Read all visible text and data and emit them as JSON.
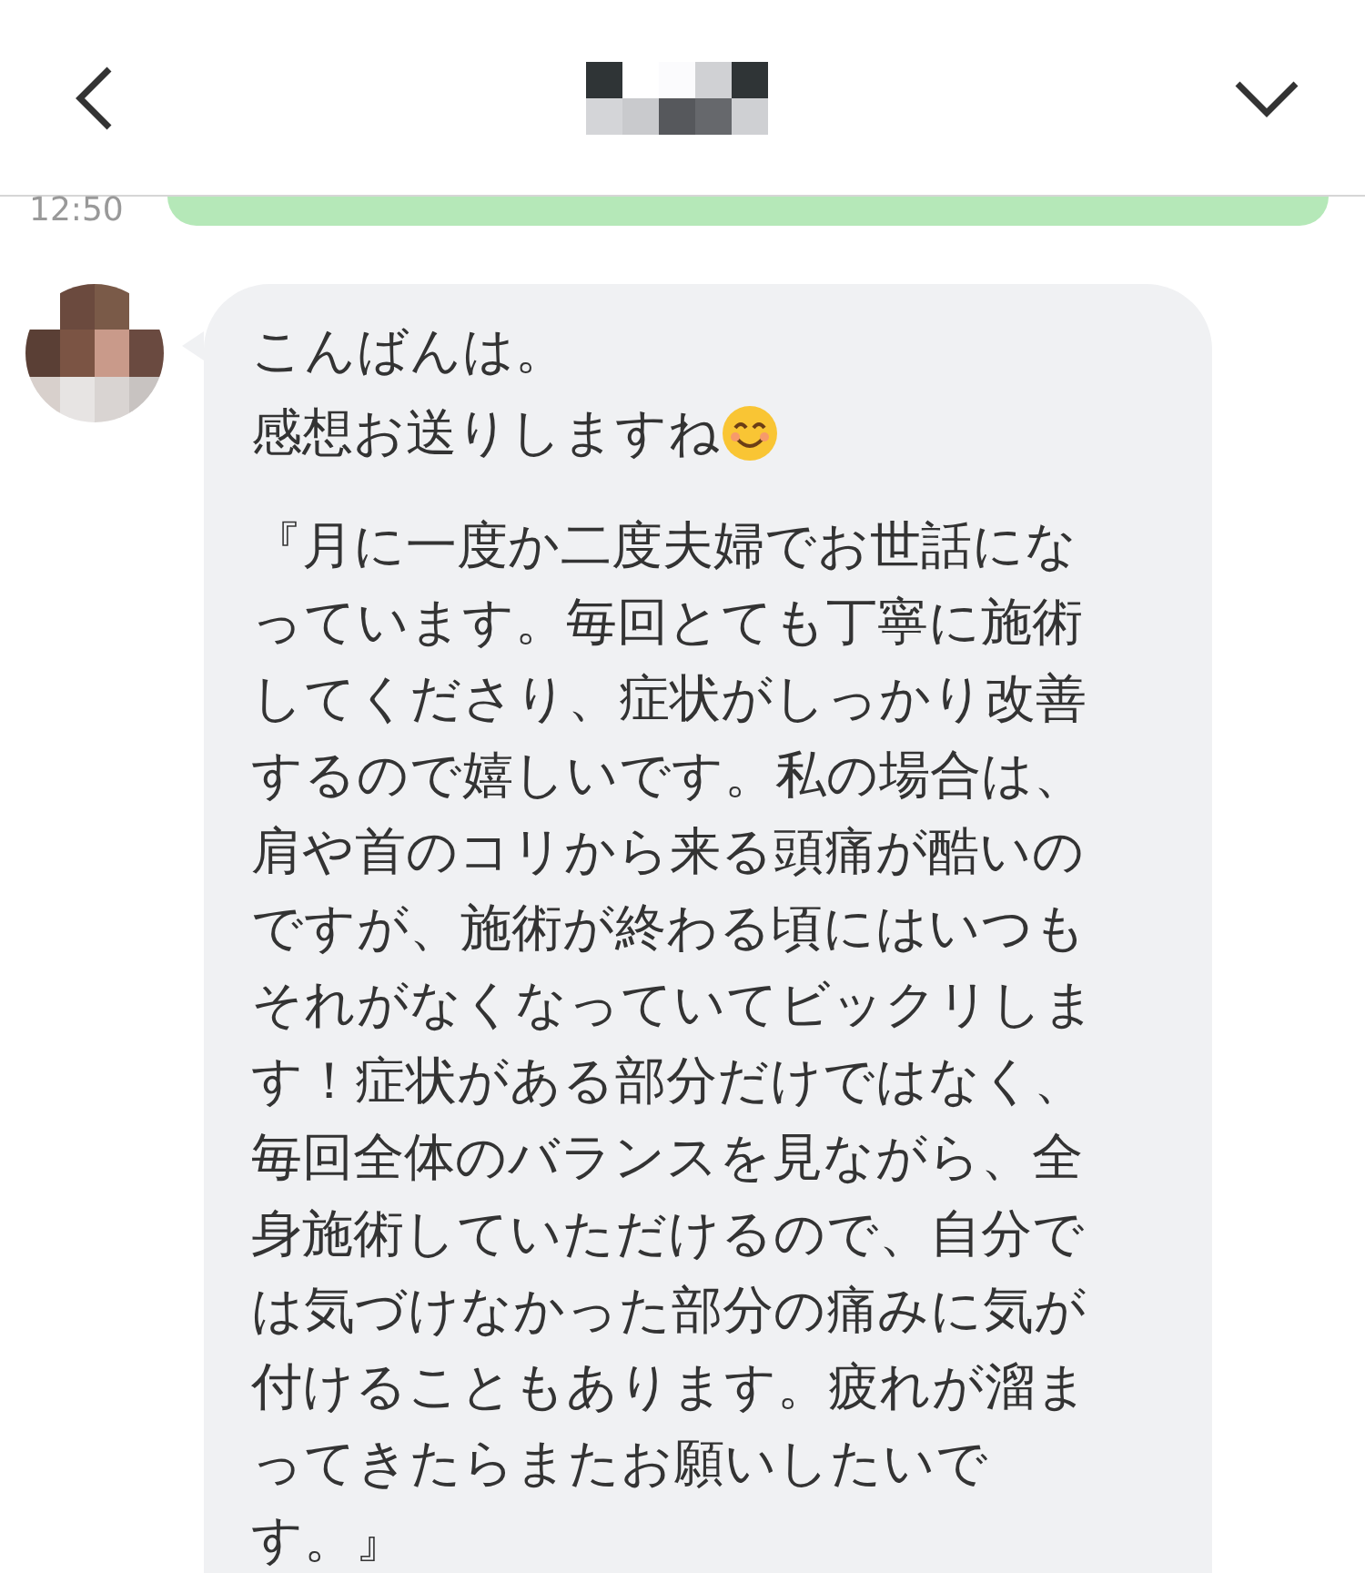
{
  "previous_message": {
    "time": "12:50"
  },
  "message": {
    "greeting": "こんばんは。",
    "intro": "感想お送りしますね",
    "body_lines": [
      "『月に一度か二度夫婦でお世話にな",
      "っています。毎回とても丁寧に施術",
      "してくださり、症状がしっかり改善",
      "するので嬉しいです。私の場合は、",
      "肩や首のコリから来る頭痛が酷いの",
      "ですが、施術が終わる頃にはいつも",
      "それがなくなっていてビックリしま",
      "す！症状がある部分だけではなく、",
      "毎回全体のバランスを見ながら、全",
      "身施術していただけるので、自分で",
      "は気づけなかった部分の痛みに気が",
      "付けることもあります。疲れが溜ま",
      "ってきたらまたお願いしたいで",
      "す。』"
    ]
  }
}
